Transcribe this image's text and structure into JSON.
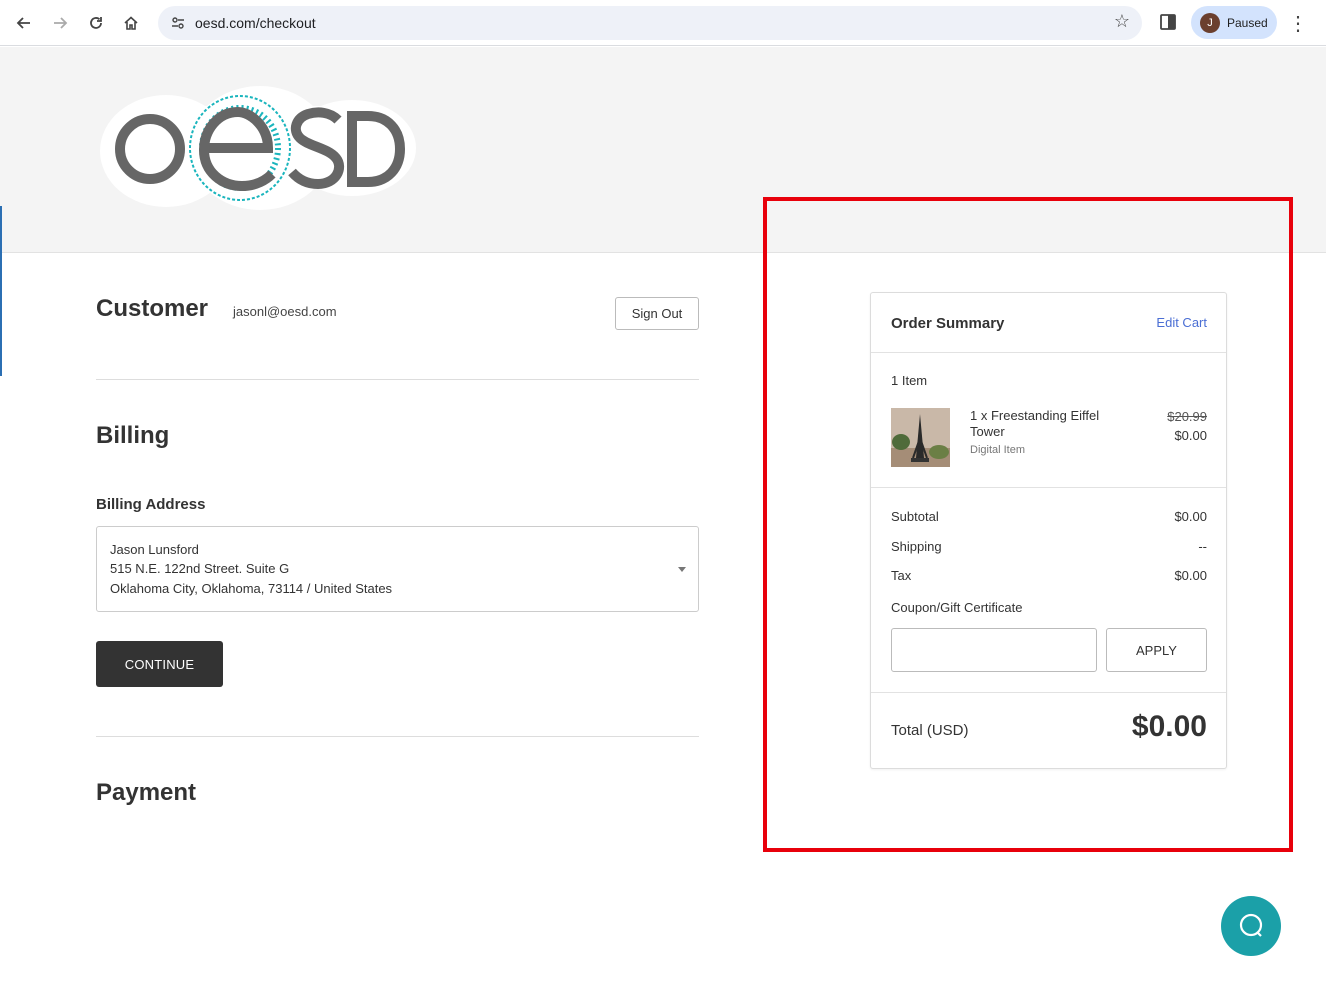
{
  "browser": {
    "url": "oesd.com/checkout",
    "profile_initial": "J",
    "profile_status": "Paused"
  },
  "header": {
    "logo_text": "OeSD",
    "logo_colors": {
      "grey": "#666666",
      "teal": "#1ab5bd"
    }
  },
  "customer": {
    "title": "Customer",
    "email": "jasonl@oesd.com",
    "sign_out_label": "Sign Out"
  },
  "billing": {
    "title": "Billing",
    "address_label": "Billing Address",
    "address_lines": [
      "Jason Lunsford",
      "515 N.E. 122nd Street. Suite G",
      "Oklahoma City, Oklahoma, 73114 / United States"
    ],
    "continue_label": "CONTINUE"
  },
  "payment": {
    "title": "Payment"
  },
  "order_summary": {
    "title": "Order Summary",
    "edit_cart_label": "Edit Cart",
    "item_count": "1 Item",
    "items": [
      {
        "name": "1 x Freestanding Eiffel Tower",
        "type": "Digital Item",
        "original_price": "$20.99",
        "price": "$0.00"
      }
    ],
    "subtotal_label": "Subtotal",
    "subtotal": "$0.00",
    "shipping_label": "Shipping",
    "shipping": "--",
    "tax_label": "Tax",
    "tax": "$0.00",
    "coupon_label": "Coupon/Gift Certificate",
    "coupon_value": "",
    "apply_label": "APPLY",
    "total_label": "Total (USD)",
    "total": "$0.00"
  },
  "colors": {
    "highlight": "#e8000b",
    "chat_button": "#1ba0a8",
    "link": "#4a6ed4"
  }
}
